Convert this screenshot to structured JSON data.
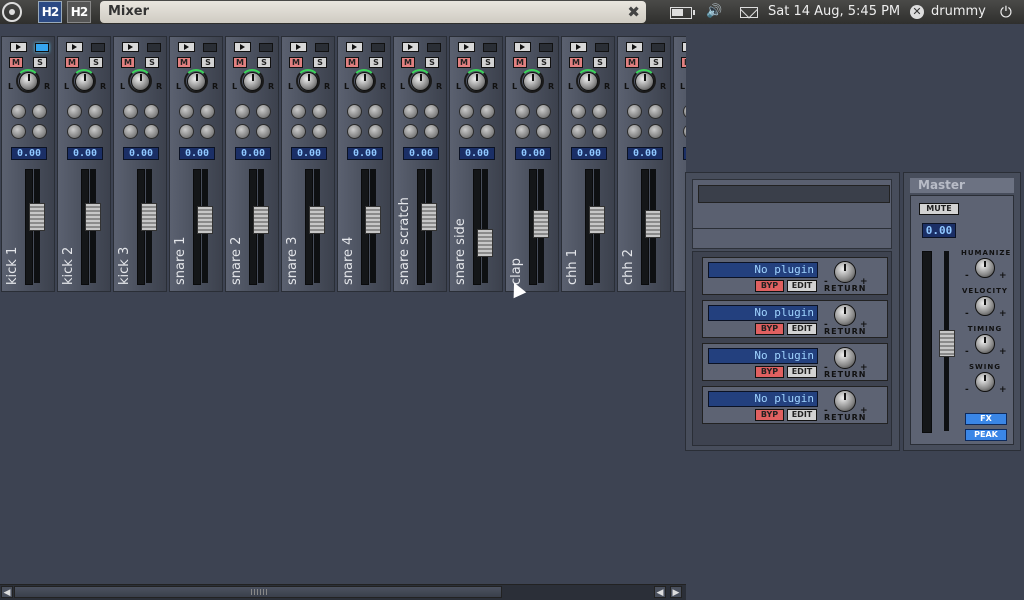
{
  "topbar": {
    "window_title": "Mixer",
    "close_glyph": "✖",
    "h2_icon_1": "H2",
    "h2_icon_2": "H2",
    "volume_glyph": "🔊",
    "clock": "Sat 14 Aug,  5:45 PM",
    "user_glyph": "✕",
    "username": "drummy",
    "power_glyph": "⏻",
    "icons": [
      "ubuntu-logo-icon",
      "hydrogen-app-icon",
      "hydrogen-app-icon",
      "battery-icon",
      "volume-icon",
      "mail-icon",
      "user-icon",
      "power-icon"
    ]
  },
  "strips": [
    {
      "name": "kick 1",
      "value": "0.00",
      "led_on": true,
      "fader_level": 0.6
    },
    {
      "name": "kick 2",
      "value": "0.00",
      "led_on": false,
      "fader_level": 0.6
    },
    {
      "name": "kick 3",
      "value": "0.00",
      "led_on": false,
      "fader_level": 0.6
    },
    {
      "name": "snare 1",
      "value": "0.00",
      "led_on": false,
      "fader_level": 0.57
    },
    {
      "name": "snare 2",
      "value": "0.00",
      "led_on": false,
      "fader_level": 0.57
    },
    {
      "name": "snare 3",
      "value": "0.00",
      "led_on": false,
      "fader_level": 0.57
    },
    {
      "name": "snare 4",
      "value": "0.00",
      "led_on": false,
      "fader_level": 0.57
    },
    {
      "name": "snare scratch",
      "value": "0.00",
      "led_on": false,
      "fader_level": 0.6
    },
    {
      "name": "snare side",
      "value": "0.00",
      "led_on": false,
      "fader_level": 0.3
    },
    {
      "name": "clap",
      "value": "0.00",
      "led_on": false,
      "fader_level": 0.52
    },
    {
      "name": "chh 1",
      "value": "0.00",
      "led_on": false,
      "fader_level": 0.57
    },
    {
      "name": "chh 2",
      "value": "0.00",
      "led_on": false,
      "fader_level": 0.52
    },
    {
      "name": "",
      "value": "",
      "led_on": false,
      "fader_level": 0.5
    }
  ],
  "strip_labels": {
    "mute": "M",
    "solo": "S",
    "pan_left": "L",
    "pan_right": "R"
  },
  "fx": {
    "slots": [
      {
        "plugin": "No plugin",
        "bypass": "BYP",
        "edit": "EDIT",
        "return": "RETURN"
      },
      {
        "plugin": "No plugin",
        "bypass": "BYP",
        "edit": "EDIT",
        "return": "RETURN"
      },
      {
        "plugin": "No plugin",
        "bypass": "BYP",
        "edit": "EDIT",
        "return": "RETURN"
      },
      {
        "plugin": "No plugin",
        "bypass": "BYP",
        "edit": "EDIT",
        "return": "RETURN"
      }
    ],
    "minus": "-",
    "plus": "+"
  },
  "master": {
    "title": "Master",
    "mute": "MUTE",
    "value": "0.00",
    "knobs": [
      "HUMANIZE",
      "VELOCITY",
      "TIMING",
      "SWING"
    ],
    "fx_button": "FX",
    "peak_button": "PEAK"
  },
  "scrollbar": {
    "left_arrow": "◀",
    "right_arrow": "▶",
    "prev_arrow": "◀"
  },
  "colors": {
    "background": "#3d4352",
    "lcd": "#1b2f66",
    "lcd_text": "#8fc7ff",
    "mute_red": "#e28080",
    "accent_blue": "#3a86e6"
  }
}
